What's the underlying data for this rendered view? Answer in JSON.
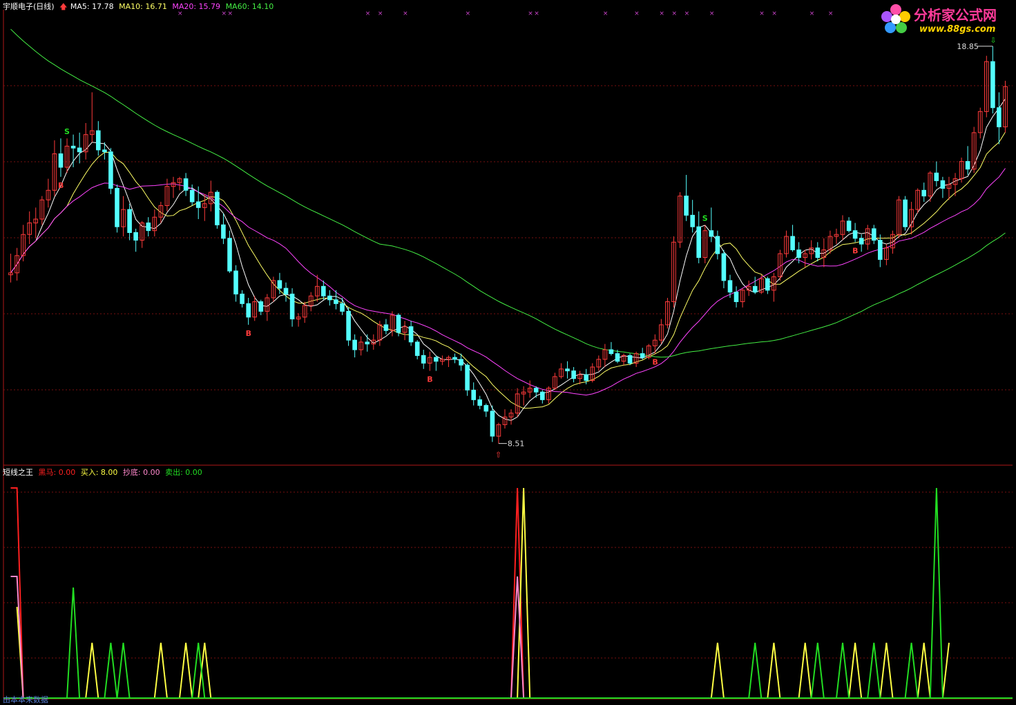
{
  "header": {
    "stock": "宇顺电子(日线)",
    "ma5": "MA5: 17.78",
    "ma10": "MA10: 16.71",
    "ma20": "MA20: 15.79",
    "ma60": "MA60: 14.10"
  },
  "indicator": {
    "name": "短线之王",
    "heima": "黑马: 0.00",
    "buy": "买入: 8.00",
    "chaodi": "抄底: 0.00",
    "sell": "卖出: 0.00"
  },
  "logo": {
    "title": "分析家公式网",
    "url": "www.88gs.com"
  },
  "footer": "由本本来数据",
  "colors": {
    "up": "#ff3b3b",
    "down": "#54ffff",
    "ma5": "#ffffff",
    "ma10": "#ffff66",
    "ma20": "#ff44ff",
    "ma60": "#44ee44",
    "grid": "#7a1010",
    "heima": "#ff2020",
    "buy": "#ffff44",
    "chaodi": "#ff88cc",
    "sell": "#22dd22"
  },
  "chart_data": {
    "type": "candlestick",
    "price_labels": {
      "high": "18.85",
      "low": "8.51"
    },
    "ylim_price": [
      8.0,
      19.8
    ],
    "price_high": 18.85,
    "price_low": 8.51,
    "ohlc": [
      [
        12.9,
        13.45,
        12.7,
        12.95
      ],
      [
        12.95,
        13.6,
        12.75,
        13.4
      ],
      [
        13.4,
        14.2,
        13.25,
        13.95
      ],
      [
        13.95,
        14.55,
        13.7,
        14.25
      ],
      [
        14.25,
        14.65,
        13.85,
        14.35
      ],
      [
        14.35,
        14.95,
        14.2,
        14.85
      ],
      [
        14.85,
        15.4,
        14.65,
        15.1
      ],
      [
        15.1,
        16.4,
        14.95,
        16.05
      ],
      [
        16.05,
        16.45,
        15.45,
        15.7
      ],
      [
        15.7,
        16.45,
        15.55,
        16.25
      ],
      [
        16.25,
        16.55,
        15.7,
        16.2
      ],
      [
        16.2,
        16.6,
        15.8,
        16.1
      ],
      [
        16.1,
        16.85,
        15.9,
        16.55
      ],
      [
        16.55,
        17.65,
        16.35,
        16.65
      ],
      [
        16.65,
        16.9,
        16.0,
        16.15
      ],
      [
        16.15,
        16.35,
        15.9,
        16.1
      ],
      [
        16.1,
        16.2,
        15.0,
        15.15
      ],
      [
        15.15,
        15.25,
        14.0,
        14.15
      ],
      [
        14.15,
        14.95,
        13.9,
        14.6
      ],
      [
        14.6,
        14.75,
        13.8,
        14.0
      ],
      [
        14.0,
        14.1,
        13.5,
        13.8
      ],
      [
        13.8,
        14.3,
        13.6,
        14.25
      ],
      [
        14.25,
        14.4,
        13.9,
        14.05
      ],
      [
        14.05,
        14.6,
        13.9,
        14.4
      ],
      [
        14.4,
        14.8,
        14.25,
        14.7
      ],
      [
        14.7,
        15.4,
        14.55,
        15.2
      ],
      [
        15.2,
        15.45,
        14.9,
        15.3
      ],
      [
        15.3,
        15.45,
        15.1,
        15.4
      ],
      [
        15.4,
        15.55,
        14.95,
        15.1
      ],
      [
        15.1,
        15.25,
        14.7,
        14.8
      ],
      [
        14.8,
        15.2,
        14.35,
        14.65
      ],
      [
        14.65,
        15.0,
        14.3,
        14.75
      ],
      [
        14.75,
        15.35,
        14.55,
        15.05
      ],
      [
        15.05,
        15.1,
        14.1,
        14.2
      ],
      [
        14.2,
        14.5,
        13.7,
        13.85
      ],
      [
        13.85,
        14.05,
        12.95,
        13.0
      ],
      [
        13.0,
        13.15,
        12.2,
        12.4
      ],
      [
        12.4,
        12.5,
        12.05,
        12.15
      ],
      [
        12.15,
        12.3,
        11.6,
        11.8
      ],
      [
        11.8,
        12.35,
        11.7,
        12.2
      ],
      [
        12.2,
        12.25,
        11.85,
        11.95
      ],
      [
        11.95,
        12.4,
        11.7,
        12.3
      ],
      [
        12.3,
        12.85,
        12.2,
        12.75
      ],
      [
        12.75,
        12.95,
        12.4,
        12.55
      ],
      [
        12.55,
        12.7,
        12.2,
        12.4
      ],
      [
        12.4,
        12.55,
        11.55,
        11.75
      ],
      [
        11.75,
        11.9,
        11.55,
        11.8
      ],
      [
        11.8,
        12.2,
        11.65,
        12.1
      ],
      [
        12.1,
        12.45,
        11.95,
        12.35
      ],
      [
        12.35,
        12.9,
        12.2,
        12.6
      ],
      [
        12.6,
        12.75,
        12.25,
        12.35
      ],
      [
        12.35,
        12.5,
        12.1,
        12.25
      ],
      [
        12.25,
        12.5,
        12.0,
        12.15
      ],
      [
        12.15,
        12.3,
        11.85,
        11.95
      ],
      [
        11.95,
        12.05,
        11.05,
        11.2
      ],
      [
        11.2,
        11.35,
        10.75,
        10.95
      ],
      [
        10.95,
        11.3,
        10.8,
        11.15
      ],
      [
        11.15,
        11.35,
        10.9,
        11.1
      ],
      [
        11.1,
        11.35,
        10.95,
        11.2
      ],
      [
        11.2,
        11.7,
        11.05,
        11.6
      ],
      [
        11.6,
        11.75,
        11.35,
        11.45
      ],
      [
        11.45,
        11.95,
        11.3,
        11.85
      ],
      [
        11.85,
        11.9,
        11.3,
        11.4
      ],
      [
        11.4,
        11.7,
        11.2,
        11.55
      ],
      [
        11.55,
        11.7,
        11.05,
        11.15
      ],
      [
        11.15,
        11.2,
        10.7,
        10.8
      ],
      [
        10.8,
        10.95,
        10.45,
        10.6
      ],
      [
        10.6,
        10.9,
        10.4,
        10.75
      ],
      [
        10.75,
        10.8,
        10.4,
        10.65
      ],
      [
        10.65,
        10.8,
        10.55,
        10.7
      ],
      [
        10.7,
        10.8,
        10.5,
        10.75
      ],
      [
        10.75,
        10.85,
        10.6,
        10.7
      ],
      [
        10.7,
        10.85,
        10.4,
        10.55
      ],
      [
        10.55,
        10.6,
        9.75,
        9.9
      ],
      [
        9.9,
        10.1,
        9.5,
        9.65
      ],
      [
        9.65,
        9.75,
        9.4,
        9.5
      ],
      [
        9.5,
        9.55,
        9.2,
        9.35
      ],
      [
        9.35,
        9.5,
        8.55,
        8.7
      ],
      [
        8.7,
        9.05,
        8.51,
        9.0
      ],
      [
        9.0,
        9.4,
        8.9,
        9.2
      ],
      [
        9.2,
        9.4,
        9.0,
        9.3
      ],
      [
        9.3,
        9.95,
        9.2,
        9.8
      ],
      [
        9.8,
        10.0,
        9.5,
        9.85
      ],
      [
        9.85,
        10.15,
        9.7,
        9.95
      ],
      [
        9.95,
        10.0,
        9.7,
        9.85
      ],
      [
        9.85,
        9.9,
        9.55,
        9.65
      ],
      [
        9.65,
        10.0,
        9.55,
        9.95
      ],
      [
        9.95,
        10.35,
        9.9,
        10.25
      ],
      [
        10.25,
        10.6,
        10.2,
        10.45
      ],
      [
        10.45,
        10.65,
        10.2,
        10.4
      ],
      [
        10.4,
        10.5,
        10.1,
        10.2
      ],
      [
        10.2,
        10.4,
        10.05,
        10.3
      ],
      [
        10.3,
        10.45,
        10.05,
        10.15
      ],
      [
        10.15,
        10.6,
        10.1,
        10.5
      ],
      [
        10.5,
        10.8,
        10.4,
        10.7
      ],
      [
        10.7,
        11.1,
        10.5,
        10.95
      ],
      [
        10.95,
        11.15,
        10.8,
        10.85
      ],
      [
        10.85,
        10.95,
        10.6,
        10.65
      ],
      [
        10.65,
        10.85,
        10.55,
        10.8
      ],
      [
        10.8,
        10.85,
        10.55,
        10.6
      ],
      [
        10.6,
        10.9,
        10.5,
        10.85
      ],
      [
        10.85,
        11.0,
        10.7,
        10.75
      ],
      [
        10.75,
        11.1,
        10.7,
        11.05
      ],
      [
        11.05,
        11.35,
        10.85,
        11.2
      ],
      [
        11.2,
        11.75,
        11.1,
        11.6
      ],
      [
        11.6,
        12.3,
        11.5,
        12.2
      ],
      [
        12.2,
        13.9,
        12.05,
        13.75
      ],
      [
        13.75,
        15.05,
        13.6,
        14.95
      ],
      [
        14.95,
        15.5,
        14.3,
        14.45
      ],
      [
        14.45,
        14.85,
        14.0,
        14.15
      ],
      [
        14.15,
        14.55,
        13.2,
        13.35
      ],
      [
        13.35,
        14.2,
        13.2,
        14.05
      ],
      [
        14.05,
        14.65,
        13.75,
        13.9
      ],
      [
        13.9,
        14.05,
        13.3,
        13.45
      ],
      [
        13.45,
        13.55,
        12.55,
        12.75
      ],
      [
        12.75,
        12.9,
        12.3,
        12.45
      ],
      [
        12.45,
        12.6,
        12.05,
        12.2
      ],
      [
        12.2,
        12.55,
        12.05,
        12.5
      ],
      [
        12.5,
        12.75,
        12.35,
        12.6
      ],
      [
        12.6,
        12.85,
        12.4,
        12.45
      ],
      [
        12.45,
        12.9,
        12.4,
        12.8
      ],
      [
        12.8,
        12.85,
        12.4,
        12.5
      ],
      [
        12.5,
        12.95,
        12.2,
        12.85
      ],
      [
        12.85,
        13.55,
        12.75,
        13.45
      ],
      [
        13.45,
        14.05,
        13.35,
        13.9
      ],
      [
        13.9,
        14.2,
        13.5,
        13.55
      ],
      [
        13.55,
        13.75,
        13.2,
        13.35
      ],
      [
        13.35,
        13.55,
        13.1,
        13.45
      ],
      [
        13.45,
        13.8,
        13.3,
        13.6
      ],
      [
        13.6,
        13.75,
        13.25,
        13.35
      ],
      [
        13.35,
        13.85,
        13.1,
        13.55
      ],
      [
        13.55,
        14.05,
        13.45,
        13.9
      ],
      [
        13.9,
        14.1,
        13.7,
        13.95
      ],
      [
        13.95,
        14.45,
        13.8,
        14.3
      ],
      [
        14.3,
        14.4,
        14.0,
        14.05
      ],
      [
        14.05,
        14.25,
        13.75,
        13.85
      ],
      [
        13.85,
        13.95,
        13.5,
        13.7
      ],
      [
        13.7,
        14.2,
        13.55,
        14.1
      ],
      [
        14.1,
        14.2,
        13.7,
        13.8
      ],
      [
        13.8,
        13.95,
        13.1,
        13.3
      ],
      [
        13.3,
        13.7,
        13.15,
        13.6
      ],
      [
        13.6,
        14.05,
        13.45,
        13.95
      ],
      [
        13.95,
        14.95,
        13.85,
        14.85
      ],
      [
        14.85,
        14.95,
        14.05,
        14.15
      ],
      [
        14.15,
        14.8,
        13.95,
        14.6
      ],
      [
        14.6,
        15.15,
        14.5,
        15.1
      ],
      [
        15.1,
        15.3,
        14.8,
        14.95
      ],
      [
        14.95,
        15.6,
        14.8,
        15.55
      ],
      [
        15.55,
        15.85,
        15.2,
        15.35
      ],
      [
        15.35,
        15.45,
        14.9,
        15.15
      ],
      [
        15.15,
        15.45,
        14.85,
        15.25
      ],
      [
        15.25,
        15.55,
        14.95,
        15.4
      ],
      [
        15.4,
        15.95,
        15.3,
        15.85
      ],
      [
        15.85,
        16.25,
        15.5,
        15.65
      ],
      [
        15.65,
        16.75,
        15.55,
        16.6
      ],
      [
        16.6,
        17.25,
        16.45,
        17.15
      ],
      [
        17.15,
        18.6,
        17.0,
        18.45
      ],
      [
        18.45,
        18.85,
        17.1,
        17.25
      ],
      [
        17.25,
        17.65,
        16.3,
        16.75
      ],
      [
        16.75,
        17.95,
        16.6,
        17.8
      ]
    ],
    "indicator_series": [
      {
        "name": "黑马",
        "color": "#ff2020",
        "values": [
          [
            0,
            7.6
          ],
          [
            1,
            7.6
          ],
          [
            2,
            0
          ],
          [
            80,
            0
          ],
          [
            81,
            7.6
          ],
          [
            82,
            0
          ]
        ]
      },
      {
        "name": "买入",
        "color": "#ffff44",
        "values": [
          [
            1,
            3.3
          ],
          [
            2,
            0
          ],
          [
            12,
            0
          ],
          [
            13,
            2.0
          ],
          [
            14,
            0
          ],
          [
            23,
            0
          ],
          [
            24,
            2.0
          ],
          [
            25,
            0
          ],
          [
            27,
            0
          ],
          [
            28,
            2.0
          ],
          [
            29,
            0
          ],
          [
            30,
            0
          ],
          [
            31,
            2.0
          ],
          [
            32,
            0
          ],
          [
            81,
            0
          ],
          [
            82,
            7.6
          ],
          [
            83,
            0
          ],
          [
            112,
            0
          ],
          [
            113,
            2.0
          ],
          [
            114,
            0
          ],
          [
            121,
            0
          ],
          [
            122,
            2.0
          ],
          [
            123,
            0
          ],
          [
            126,
            0
          ],
          [
            127,
            2.0
          ],
          [
            128,
            0
          ],
          [
            134,
            0
          ],
          [
            135,
            2.0
          ],
          [
            136,
            0
          ],
          [
            139,
            0
          ],
          [
            140,
            2.0
          ],
          [
            141,
            0
          ],
          [
            145,
            0
          ],
          [
            146,
            2.0
          ],
          [
            147,
            0
          ],
          [
            149,
            0
          ],
          [
            150,
            2.0
          ]
        ]
      },
      {
        "name": "抄底",
        "color": "#ff88cc",
        "values": [
          [
            0,
            4.4
          ],
          [
            1,
            4.4
          ],
          [
            2,
            0
          ],
          [
            80,
            0
          ],
          [
            81,
            4.4
          ],
          [
            82,
            0
          ]
        ]
      },
      {
        "name": "卖出",
        "color": "#22dd22",
        "values": [
          [
            9,
            0
          ],
          [
            10,
            4.0
          ],
          [
            11,
            0
          ],
          [
            15,
            0
          ],
          [
            16,
            2.0
          ],
          [
            17,
            0
          ],
          [
            17,
            0
          ],
          [
            18,
            2.0
          ],
          [
            19,
            0
          ],
          [
            29,
            0
          ],
          [
            30,
            2.0
          ],
          [
            31,
            0
          ],
          [
            118,
            0
          ],
          [
            119,
            2.0
          ],
          [
            120,
            0
          ],
          [
            128,
            0
          ],
          [
            129,
            2.0
          ],
          [
            130,
            0
          ],
          [
            132,
            0
          ],
          [
            133,
            2.0
          ],
          [
            134,
            0
          ],
          [
            137,
            0
          ],
          [
            138,
            2.0
          ],
          [
            139,
            0
          ],
          [
            143,
            0
          ],
          [
            144,
            2.0
          ],
          [
            145,
            0
          ],
          [
            147,
            0
          ],
          [
            148,
            7.6
          ],
          [
            149,
            0
          ]
        ]
      }
    ],
    "ylim_indicator": [
      0,
      8
    ],
    "signals": [
      {
        "i": 8,
        "text": "B",
        "color": "#ff3b3b",
        "pos": "below"
      },
      {
        "i": 9,
        "text": "S",
        "color": "#22dd22",
        "pos": "above"
      },
      {
        "i": 38,
        "text": "B",
        "color": "#ff3b3b",
        "pos": "below"
      },
      {
        "i": 67,
        "text": "B",
        "color": "#ff3b3b",
        "pos": "below"
      },
      {
        "i": 103,
        "text": "B",
        "color": "#ff3b3b",
        "pos": "below"
      },
      {
        "i": 111,
        "text": "S",
        "color": "#22dd22",
        "pos": "above"
      },
      {
        "i": 135,
        "text": "B",
        "color": "#ff3b3b",
        "pos": "below"
      }
    ],
    "x_markers": [
      27,
      34,
      35,
      57,
      59,
      63,
      73,
      83,
      84,
      95,
      100,
      104,
      106,
      108,
      112,
      120,
      122,
      128,
      131
    ]
  }
}
